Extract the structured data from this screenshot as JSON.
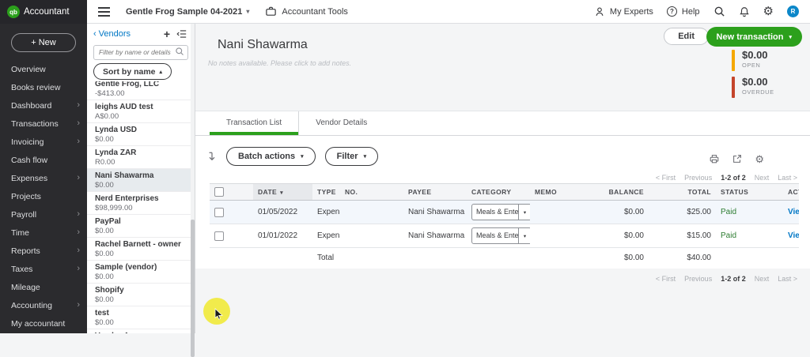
{
  "topbar": {
    "logo_monogram": "qb",
    "logo_text": "Accountant",
    "company_name": "Gentle Frog Sample 04-2021",
    "accountant_tools_label": "Accountant Tools",
    "my_experts_label": "My Experts",
    "help_label": "Help",
    "help_glyph": "?",
    "avatar_initial": "R"
  },
  "glyphs": {
    "caret_down": "▾",
    "caret_up": "▴",
    "chevron_right": "›",
    "back": "‹",
    "plus": "+",
    "gear": "⚙"
  },
  "sidebar": {
    "new_button_label": "+ New",
    "items": [
      {
        "label": "Overview",
        "arrow": false
      },
      {
        "label": "Books review",
        "arrow": false
      },
      {
        "label": "Dashboard",
        "arrow": true
      },
      {
        "label": "Transactions",
        "arrow": true
      },
      {
        "label": "Invoicing",
        "arrow": true
      },
      {
        "label": "Cash flow",
        "arrow": false
      },
      {
        "label": "Expenses",
        "arrow": true
      },
      {
        "label": "Projects",
        "arrow": false
      },
      {
        "label": "Payroll",
        "arrow": true
      },
      {
        "label": "Time",
        "arrow": true
      },
      {
        "label": "Reports",
        "arrow": true
      },
      {
        "label": "Taxes",
        "arrow": true
      },
      {
        "label": "Mileage",
        "arrow": false
      },
      {
        "label": "Accounting",
        "arrow": true
      },
      {
        "label": "My accountant",
        "arrow": false
      }
    ]
  },
  "vendors_panel": {
    "back_label": "Vendors",
    "filter_placeholder": "Filter by name or details",
    "sort_label": "Sort by name",
    "vendors": [
      {
        "name": "Gentle Frog, LLC",
        "balance": "-$413.00",
        "selected": false
      },
      {
        "name": "leighs AUD test",
        "balance": "A$0.00",
        "selected": false
      },
      {
        "name": "Lynda USD",
        "balance": "$0.00",
        "selected": false
      },
      {
        "name": "Lynda ZAR",
        "balance": "R0.00",
        "selected": false
      },
      {
        "name": "Nani Shawarma",
        "balance": "$0.00",
        "selected": true
      },
      {
        "name": "Nerd Enterprises",
        "balance": "$98,999.00",
        "selected": false
      },
      {
        "name": "PayPal",
        "balance": "$0.00",
        "selected": false
      },
      {
        "name": "Rachel Barnett - owner",
        "balance": "$0.00",
        "selected": false
      },
      {
        "name": "Sample (vendor)",
        "balance": "$0.00",
        "selected": false
      },
      {
        "name": "Shopify",
        "balance": "$0.00",
        "selected": false
      },
      {
        "name": "test",
        "balance": "$0.00",
        "selected": false
      },
      {
        "name": "Vendor A",
        "balance": "",
        "selected": false
      }
    ]
  },
  "main": {
    "title": "Nani Shawarma",
    "notes_placeholder": "No notes available. Please click to add notes.",
    "edit_label": "Edit",
    "new_transaction_label": "New transaction",
    "money_bars": [
      {
        "amount": "$0.00",
        "label": "OPEN",
        "color": "#f5a800"
      },
      {
        "amount": "$0.00",
        "label": "OVERDUE",
        "color": "#c4452c"
      }
    ],
    "tabs": [
      {
        "label": "Transaction List",
        "active": true
      },
      {
        "label": "Vendor Details",
        "active": false
      }
    ],
    "toolbar": {
      "batch_actions_label": "Batch actions",
      "filter_label": "Filter"
    },
    "pagination": {
      "first": "< First",
      "previous": "Previous",
      "range": "1-2 of 2",
      "next": "Next",
      "last": "Last >"
    },
    "table": {
      "columns": [
        "DATE",
        "TYPE",
        "NO.",
        "PAYEE",
        "CATEGORY",
        "MEMO",
        "BALANCE",
        "TOTAL",
        "STATUS",
        "ACTION"
      ],
      "rows": [
        {
          "date": "01/05/2022",
          "type": "Expense",
          "no": "",
          "payee": "Nani Shawarma",
          "category": "Meals & Ente",
          "memo": "",
          "balance": "$0.00",
          "total": "$25.00",
          "status": "Paid",
          "action": "View/Edit",
          "highlighted": true
        },
        {
          "date": "01/01/2022",
          "type": "Expense",
          "no": "",
          "payee": "Nani Shawarma",
          "category": "Meals & Ente",
          "memo": "",
          "balance": "$0.00",
          "total": "$15.00",
          "status": "Paid",
          "action": "View/Edit",
          "highlighted": false
        }
      ],
      "total_row": {
        "label": "Total",
        "balance": "$0.00",
        "total": "$40.00"
      }
    },
    "colors": {
      "accent_green": "#2ca01c",
      "link_blue": "#0077c5",
      "paid_green": "#2e7d32",
      "open_orange": "#f5a800",
      "overdue_red": "#c4452c"
    }
  }
}
